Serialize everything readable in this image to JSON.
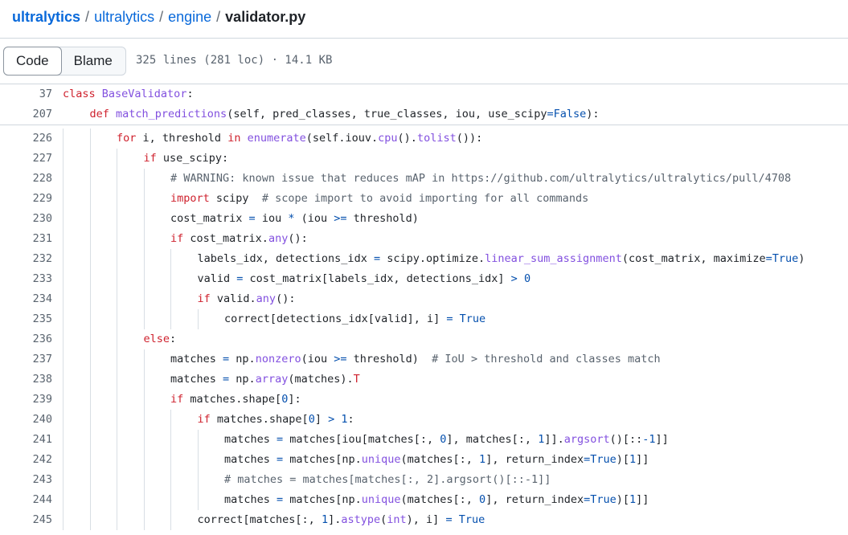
{
  "breadcrumb": {
    "parts": [
      "ultralytics",
      "ultralytics",
      "engine"
    ],
    "current": "validator.py",
    "separator": "/"
  },
  "toolbar": {
    "code_label": "Code",
    "blame_label": "Blame",
    "file_meta": "325 lines (281 loc) · 14.1 KB"
  },
  "sticky_lines": [
    {
      "num": "37",
      "indent": 0,
      "tokens": [
        [
          "kw",
          "class "
        ],
        [
          "fn",
          "BaseValidator"
        ],
        [
          "",
          "&#58;"
        ]
      ]
    },
    {
      "num": "207",
      "indent": 1,
      "tokens": [
        [
          "kw",
          "def "
        ],
        [
          "fn",
          "match_predictions"
        ],
        [
          "",
          "(self, pred_classes, true_classes, iou, use_scipy"
        ],
        [
          "op",
          "="
        ],
        [
          "bi",
          "False"
        ],
        [
          "",
          "):"
        ]
      ]
    }
  ],
  "lines": [
    {
      "num": "226",
      "indent": 2,
      "tokens": [
        [
          "kw",
          "for"
        ],
        [
          "",
          " i, threshold "
        ],
        [
          "kw",
          "in"
        ],
        [
          "",
          " "
        ],
        [
          "fn",
          "enumerate"
        ],
        [
          "",
          "(self.iouv."
        ],
        [
          "fn",
          "cpu"
        ],
        [
          "",
          "()."
        ],
        [
          "fn",
          "tolist"
        ],
        [
          "",
          "()):"
        ]
      ]
    },
    {
      "num": "227",
      "indent": 3,
      "tokens": [
        [
          "kw",
          "if"
        ],
        [
          "",
          " use_scipy:"
        ]
      ]
    },
    {
      "num": "228",
      "indent": 4,
      "tokens": [
        [
          "co",
          "# WARNING: known issue that reduces mAP in https://github.com/ultralytics/ultralytics/pull/4708"
        ]
      ]
    },
    {
      "num": "229",
      "indent": 4,
      "tokens": [
        [
          "kw",
          "import"
        ],
        [
          "",
          " scipy  "
        ],
        [
          "co",
          "# scope import to avoid importing for all commands"
        ]
      ]
    },
    {
      "num": "230",
      "indent": 4,
      "tokens": [
        [
          "",
          "cost_matrix "
        ],
        [
          "op",
          "="
        ],
        [
          "",
          " iou "
        ],
        [
          "op",
          "*"
        ],
        [
          "",
          " (iou "
        ],
        [
          "op",
          ">="
        ],
        [
          "",
          " threshold)"
        ]
      ]
    },
    {
      "num": "231",
      "indent": 4,
      "tokens": [
        [
          "kw",
          "if"
        ],
        [
          "",
          " cost_matrix."
        ],
        [
          "fn",
          "any"
        ],
        [
          "",
          "():"
        ]
      ]
    },
    {
      "num": "232",
      "indent": 5,
      "tokens": [
        [
          "",
          "labels_idx, detections_idx "
        ],
        [
          "op",
          "="
        ],
        [
          "",
          " scipy.optimize."
        ],
        [
          "fn",
          "linear_sum_assignment"
        ],
        [
          "",
          "(cost_matrix, maximize"
        ],
        [
          "op",
          "="
        ],
        [
          "bi",
          "True"
        ],
        [
          "",
          ")"
        ]
      ]
    },
    {
      "num": "233",
      "indent": 5,
      "tokens": [
        [
          "",
          "valid "
        ],
        [
          "op",
          "="
        ],
        [
          "",
          " cost_matrix[labels_idx, detections_idx] "
        ],
        [
          "op",
          ">"
        ],
        [
          "",
          " "
        ],
        [
          "nu",
          "0"
        ]
      ]
    },
    {
      "num": "234",
      "indent": 5,
      "tokens": [
        [
          "kw",
          "if"
        ],
        [
          "",
          " valid."
        ],
        [
          "fn",
          "any"
        ],
        [
          "",
          "():"
        ]
      ]
    },
    {
      "num": "235",
      "indent": 6,
      "tokens": [
        [
          "",
          "correct[detections_idx[valid], i] "
        ],
        [
          "op",
          "="
        ],
        [
          "",
          " "
        ],
        [
          "bi",
          "True"
        ]
      ]
    },
    {
      "num": "236",
      "indent": 3,
      "tokens": [
        [
          "kw",
          "else"
        ],
        [
          "",
          ":"
        ]
      ]
    },
    {
      "num": "237",
      "indent": 4,
      "tokens": [
        [
          "",
          "matches "
        ],
        [
          "op",
          "="
        ],
        [
          "",
          " np."
        ],
        [
          "fn",
          "nonzero"
        ],
        [
          "",
          "(iou "
        ],
        [
          "op",
          ">="
        ],
        [
          "",
          " threshold)  "
        ],
        [
          "co",
          "# IoU > threshold and classes match"
        ]
      ]
    },
    {
      "num": "238",
      "indent": 4,
      "tokens": [
        [
          "",
          "matches "
        ],
        [
          "op",
          "="
        ],
        [
          "",
          " np."
        ],
        [
          "fn",
          "array"
        ],
        [
          "",
          "(matches)."
        ],
        [
          "kw",
          "T"
        ]
      ]
    },
    {
      "num": "239",
      "indent": 4,
      "tokens": [
        [
          "kw",
          "if"
        ],
        [
          "",
          " matches.shape["
        ],
        [
          "nu",
          "0"
        ],
        [
          "",
          "]:"
        ]
      ]
    },
    {
      "num": "240",
      "indent": 5,
      "tokens": [
        [
          "kw",
          "if"
        ],
        [
          "",
          " matches.shape["
        ],
        [
          "nu",
          "0"
        ],
        [
          "",
          "] "
        ],
        [
          "op",
          ">"
        ],
        [
          "",
          " "
        ],
        [
          "nu",
          "1"
        ],
        [
          "",
          ":"
        ]
      ]
    },
    {
      "num": "241",
      "indent": 6,
      "tokens": [
        [
          "",
          "matches "
        ],
        [
          "op",
          "="
        ],
        [
          "",
          " matches[iou[matches[:, "
        ],
        [
          "nu",
          "0"
        ],
        [
          "",
          "], matches[:, "
        ],
        [
          "nu",
          "1"
        ],
        [
          "",
          "]]."
        ],
        [
          "fn",
          "argsort"
        ],
        [
          "",
          "()[::"
        ],
        [
          "op",
          "-"
        ],
        [
          "nu",
          "1"
        ],
        [
          "",
          "]]"
        ]
      ]
    },
    {
      "num": "242",
      "indent": 6,
      "tokens": [
        [
          "",
          "matches "
        ],
        [
          "op",
          "="
        ],
        [
          "",
          " matches[np."
        ],
        [
          "fn",
          "unique"
        ],
        [
          "",
          "(matches[:, "
        ],
        [
          "nu",
          "1"
        ],
        [
          "",
          "], return_index"
        ],
        [
          "op",
          "="
        ],
        [
          "bi",
          "True"
        ],
        [
          "",
          ")["
        ],
        [
          "nu",
          "1"
        ],
        [
          "",
          "]]"
        ]
      ]
    },
    {
      "num": "243",
      "indent": 6,
      "tokens": [
        [
          "co",
          "# matches = matches[matches[:, 2].argsort()[::-1]]"
        ]
      ]
    },
    {
      "num": "244",
      "indent": 6,
      "tokens": [
        [
          "",
          "matches "
        ],
        [
          "op",
          "="
        ],
        [
          "",
          " matches[np."
        ],
        [
          "fn",
          "unique"
        ],
        [
          "",
          "(matches[:, "
        ],
        [
          "nu",
          "0"
        ],
        [
          "",
          "], return_index"
        ],
        [
          "op",
          "="
        ],
        [
          "bi",
          "True"
        ],
        [
          "",
          ")["
        ],
        [
          "nu",
          "1"
        ],
        [
          "",
          "]]"
        ]
      ]
    },
    {
      "num": "245",
      "indent": 5,
      "tokens": [
        [
          "",
          "correct[matches[:, "
        ],
        [
          "nu",
          "1"
        ],
        [
          "",
          "]."
        ],
        [
          "fn",
          "astype"
        ],
        [
          "",
          "("
        ],
        [
          "fn",
          "int"
        ],
        [
          "",
          "), i] "
        ],
        [
          "op",
          "="
        ],
        [
          "",
          " "
        ],
        [
          "bi",
          "True"
        ]
      ]
    }
  ]
}
